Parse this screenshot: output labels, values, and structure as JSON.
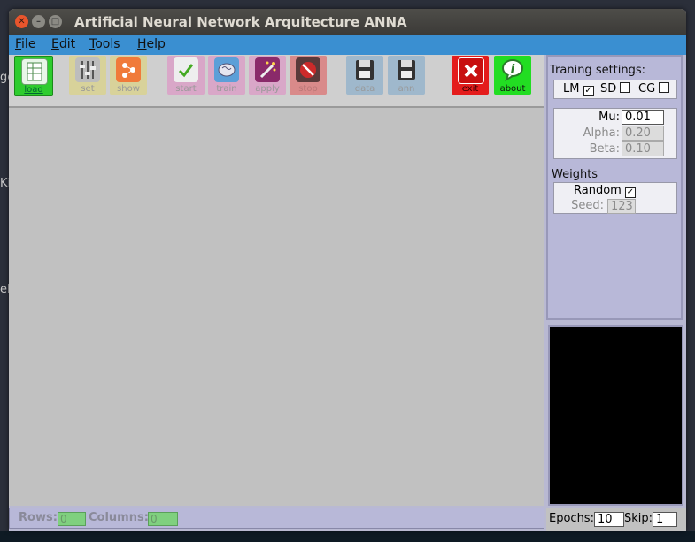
{
  "window": {
    "title": "Artificial Neural Network Arquitecture ANNA"
  },
  "desktop_fragments": [
    "ge",
    "Ki",
    "el"
  ],
  "menu": [
    {
      "label": "File",
      "ul": "F",
      "rest": "ile"
    },
    {
      "label": "Edit",
      "ul": "E",
      "rest": "dit"
    },
    {
      "label": "Tools",
      "ul": "T",
      "rest": "ools"
    },
    {
      "label": "Help",
      "ul": "H",
      "rest": "elp"
    }
  ],
  "toolbar": {
    "load": "load",
    "set": "set",
    "show": "show",
    "start": "start",
    "train": "train",
    "apply": "apply",
    "stop": "stop",
    "data": "data",
    "ann": "ann",
    "exit": "exit",
    "about": "about"
  },
  "training": {
    "heading": "Traning settings:",
    "lm": "LM",
    "sd": "SD",
    "cg": "CG",
    "lm_checked": true,
    "sd_checked": false,
    "cg_checked": false,
    "mu_label": "Mu:",
    "mu_value": "0.01",
    "alpha_label": "Alpha:",
    "alpha_value": "0.20",
    "beta_label": "Beta:",
    "beta_value": "0.10"
  },
  "weights": {
    "heading": "Weights",
    "random_label": "Random",
    "random_checked": true,
    "seed_label": "Seed:",
    "seed_value": "123"
  },
  "status": {
    "rows_label": "Rows:",
    "rows_value": "0",
    "columns_label": "Columns:",
    "columns_value": "0"
  },
  "run": {
    "epochs_label": "Epochs:",
    "epochs_value": "10",
    "skip_label": "Skip:",
    "skip_value": "1"
  },
  "colors": {
    "menubar": "#3a8fd1",
    "panel": "#b8b8d8",
    "load_green": "#2ecc2e",
    "exit_red": "#e41c1c",
    "about_green": "#22dd22"
  }
}
